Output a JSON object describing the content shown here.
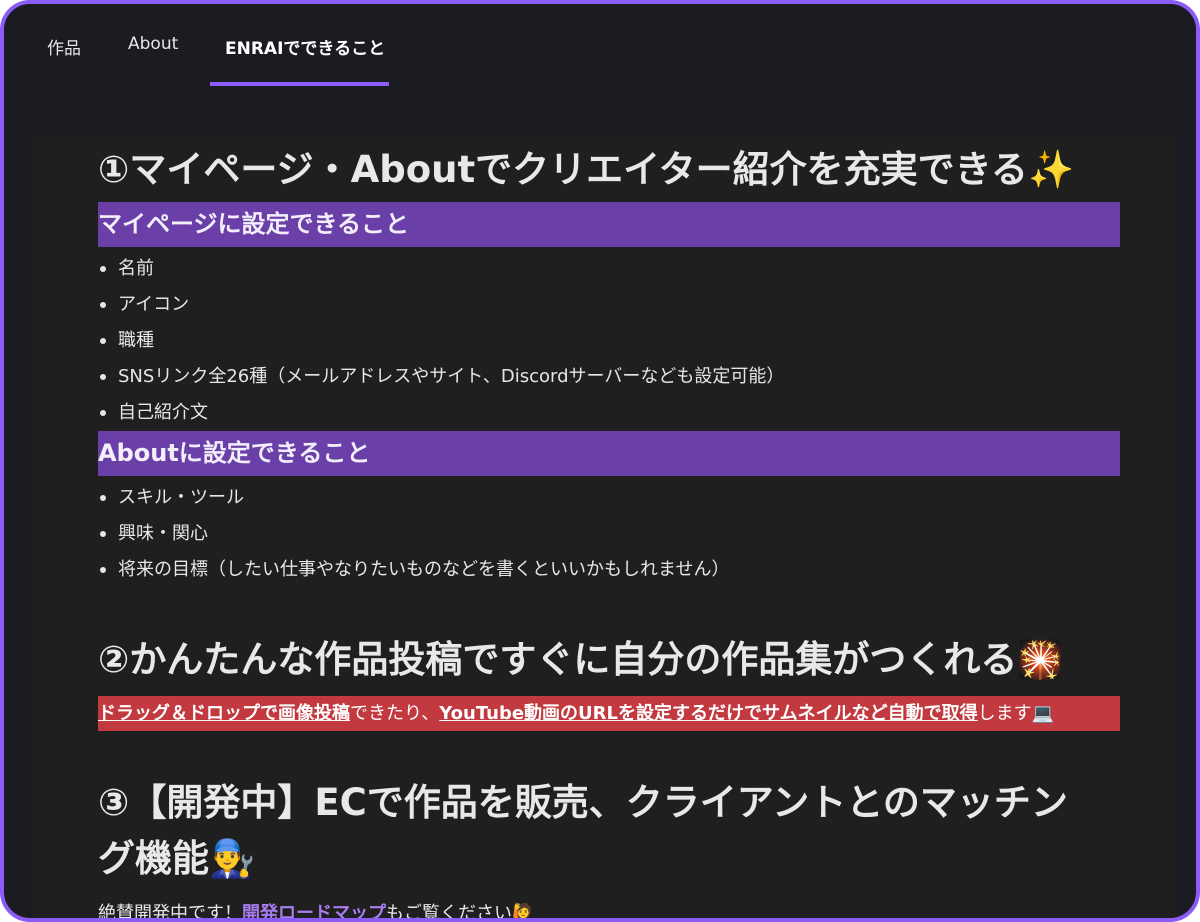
{
  "nav": {
    "tabs": [
      {
        "label": "作品"
      },
      {
        "label": "About"
      },
      {
        "label": "ENRAIでできること"
      }
    ],
    "active_tab": "ENRAIでできること"
  },
  "colors": {
    "accent": "#8b5cf6",
    "subheading_bg": "#6a3fa8",
    "highlight_bg": "#c23a3f",
    "link": "#a97df0",
    "background": "#1b1c21"
  },
  "section1": {
    "title": "①マイページ・Aboutでクリエイター紹介を充実できる",
    "title_emoji": "✨",
    "sub1": "マイページに設定できること",
    "list1": [
      "名前",
      "アイコン",
      "職種",
      "SNSリンク全26種（メールアドレスやサイト、Discordサーバーなども設定可能）",
      "自己紹介文"
    ],
    "sub2": "Aboutに設定できること",
    "list2": [
      "スキル・ツール",
      "興味・関心",
      "将来の目標（したい仕事やなりたいものなどを書くといいかもしれません）"
    ]
  },
  "section2": {
    "title": "②かんたんな作品投稿ですぐに自分の作品集がつくれる",
    "title_emoji": "🎇",
    "line_part1": "ドラッグ＆ドロップで画像投稿",
    "line_part2": "できたり、",
    "line_part3": "YouTube動画のURLを設定するだけでサムネイルなど自動で取得",
    "line_part4": "します",
    "line_emoji": "💻"
  },
  "section3": {
    "title_line1": "③【開発中】ECで作品を販売、クライアントとのマッチン",
    "title_line2": "グ機能",
    "title_emoji": "👨‍🔧",
    "text_part1": "絶賛開発中です！",
    "link": "開発ロードマップ",
    "text_part2": "もご覧ください",
    "text_emoji": "🙋"
  }
}
